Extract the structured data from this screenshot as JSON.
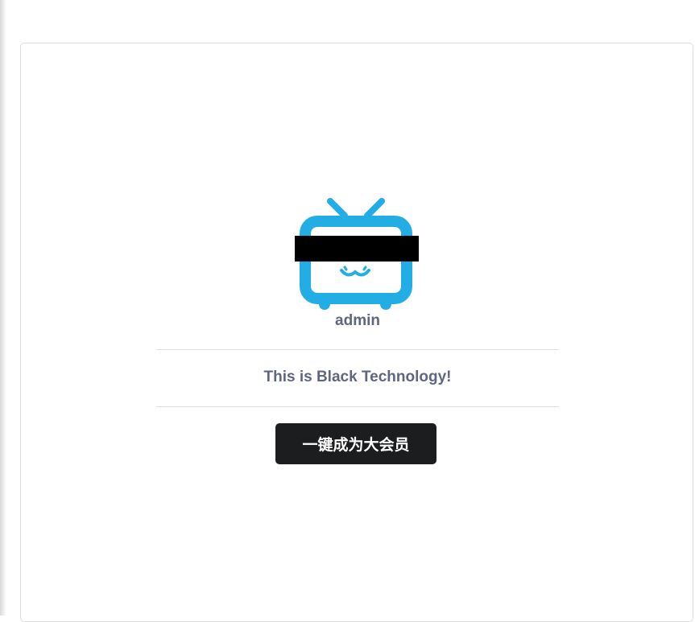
{
  "profile": {
    "avatar_icon": "tv-icon",
    "username": "admin",
    "motto": "This is Black Technology!"
  },
  "actions": {
    "vip_label": "一键成为大会员"
  },
  "colors": {
    "tv_blue": "#23ade5",
    "censor_bar": "#000000",
    "text_muted": "#5f6680",
    "button_bg": "#1c1d1f"
  }
}
